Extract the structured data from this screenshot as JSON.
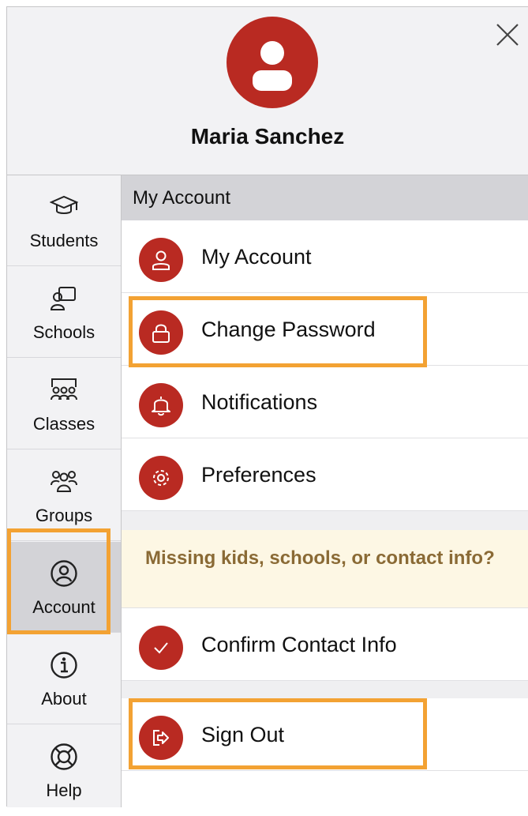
{
  "profile": {
    "name": "Maria Sanchez"
  },
  "sidebar": {
    "items": [
      {
        "label": "Students",
        "icon": "graduation-cap-icon"
      },
      {
        "label": "Schools",
        "icon": "school-icon"
      },
      {
        "label": "Classes",
        "icon": "classroom-icon"
      },
      {
        "label": "Groups",
        "icon": "groups-icon"
      },
      {
        "label": "Account",
        "icon": "account-icon",
        "active": true
      },
      {
        "label": "About",
        "icon": "info-icon"
      },
      {
        "label": "Help",
        "icon": "lifebuoy-icon"
      }
    ]
  },
  "main": {
    "section_title": "My Account",
    "items": [
      {
        "label": "My Account",
        "icon": "person-icon"
      },
      {
        "label": "Change Password",
        "icon": "lock-icon"
      },
      {
        "label": "Notifications",
        "icon": "bell-icon"
      },
      {
        "label": "Preferences",
        "icon": "gear-icon"
      }
    ],
    "banner": "Missing kids, schools, or contact info?",
    "confirm_label": "Confirm Contact Info",
    "signout_label": "Sign Out"
  },
  "colors": {
    "accent": "#b92a22",
    "highlight": "#f3a233",
    "banner_bg": "#fdf7e4",
    "banner_text": "#8a6a35"
  }
}
